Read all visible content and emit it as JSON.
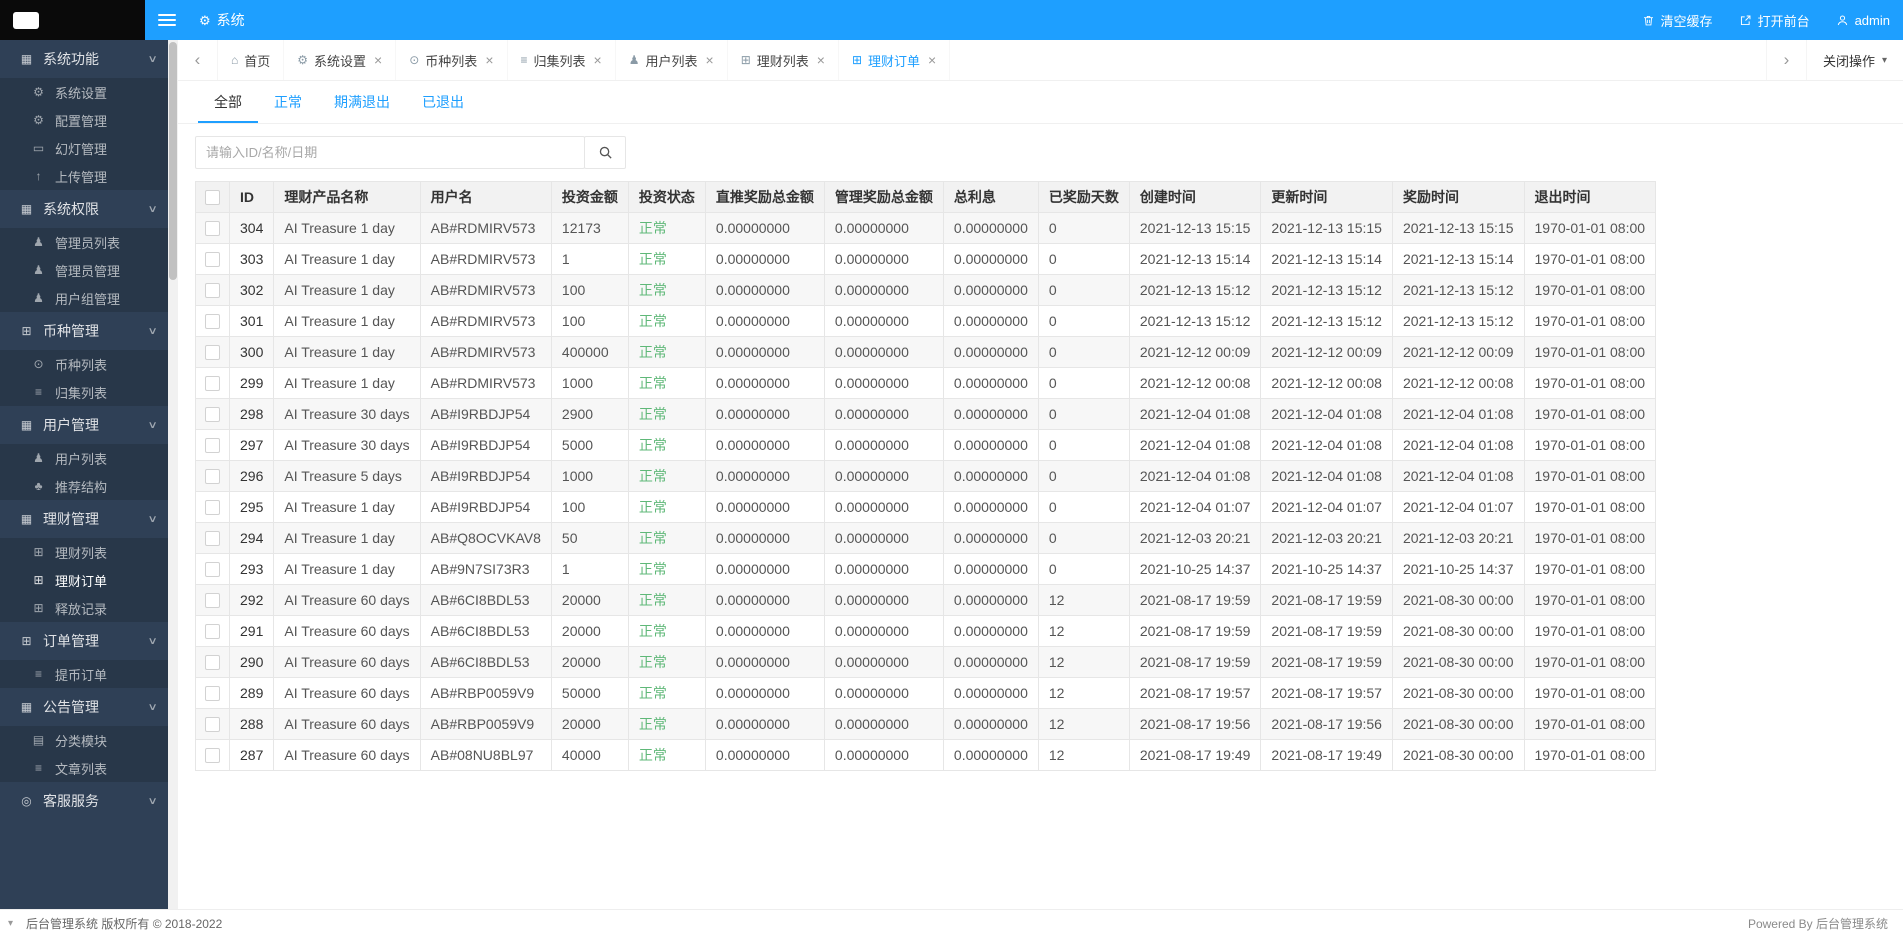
{
  "colors": {
    "primary": "#1E9FFF",
    "success": "#5FB878",
    "sidebar_bg": "#2F4056",
    "topbar_bg": "#1E9FFF"
  },
  "header": {
    "system_label": "系统",
    "actions": [
      {
        "name": "clear-cache",
        "label": "清空缓存",
        "icon": "trash-icon"
      },
      {
        "name": "open-front",
        "label": "打开前台",
        "icon": "external-link-icon"
      },
      {
        "name": "user-menu",
        "label": "admin",
        "icon": "user-icon"
      }
    ]
  },
  "sidebar": {
    "sections": [
      {
        "label": "系统功能",
        "icon": "folder-icon",
        "glyph": "▦",
        "items": [
          {
            "label": "系统设置",
            "icon": "gear-icon",
            "glyph": "⚙"
          },
          {
            "label": "配置管理",
            "icon": "gear-icon",
            "glyph": "⚙"
          },
          {
            "label": "幻灯管理",
            "icon": "slideshow-icon",
            "glyph": "▭"
          },
          {
            "label": "上传管理",
            "icon": "upload-icon",
            "glyph": "↑"
          }
        ]
      },
      {
        "label": "系统权限",
        "icon": "folder-icon",
        "glyph": "▦",
        "items": [
          {
            "label": "管理员列表",
            "icon": "user-icon",
            "glyph": "♟"
          },
          {
            "label": "管理员管理",
            "icon": "user-icon",
            "glyph": "♟"
          },
          {
            "label": "用户组管理",
            "icon": "users-icon",
            "glyph": "♟"
          }
        ]
      },
      {
        "label": "币种管理",
        "icon": "grid-icon",
        "glyph": "⊞",
        "items": [
          {
            "label": "币种列表",
            "icon": "coin-icon",
            "glyph": "⊙"
          },
          {
            "label": "归集列表",
            "icon": "list-icon",
            "glyph": "≡"
          }
        ]
      },
      {
        "label": "用户管理",
        "icon": "folder-icon",
        "glyph": "▦",
        "items": [
          {
            "label": "用户列表",
            "icon": "user-icon",
            "glyph": "♟"
          },
          {
            "label": "推荐结构",
            "icon": "tree-icon",
            "glyph": "♣"
          }
        ]
      },
      {
        "label": "理财管理",
        "icon": "folder-icon",
        "glyph": "▦",
        "items": [
          {
            "label": "理财列表",
            "icon": "grid-icon",
            "glyph": "⊞"
          },
          {
            "label": "理财订单",
            "icon": "grid-icon",
            "glyph": "⊞",
            "active": true
          },
          {
            "label": "释放记录",
            "icon": "grid-icon",
            "glyph": "⊞"
          }
        ]
      },
      {
        "label": "订单管理",
        "icon": "grid-icon",
        "glyph": "⊞",
        "items": [
          {
            "label": "提币订单",
            "icon": "list-icon",
            "glyph": "≡"
          }
        ]
      },
      {
        "label": "公告管理",
        "icon": "folder-icon",
        "glyph": "▦",
        "items": [
          {
            "label": "分类模块",
            "icon": "card-icon",
            "glyph": "▤"
          },
          {
            "label": "文章列表",
            "icon": "list-icon",
            "glyph": "≡"
          }
        ]
      },
      {
        "label": "客服服务",
        "icon": "headset-icon",
        "glyph": "◎",
        "items": []
      }
    ]
  },
  "tabbar": {
    "tabs": [
      {
        "label": "首页",
        "icon": "home-icon",
        "glyph": "⌂",
        "closable": false
      },
      {
        "label": "系统设置",
        "icon": "wrench-icon",
        "glyph": "⚙",
        "closable": true
      },
      {
        "label": "币种列表",
        "icon": "coin-icon",
        "glyph": "⊙",
        "closable": true
      },
      {
        "label": "归集列表",
        "icon": "list-icon",
        "glyph": "≡",
        "closable": true
      },
      {
        "label": "用户列表",
        "icon": "user-icon",
        "glyph": "♟",
        "closable": true
      },
      {
        "label": "理财列表",
        "icon": "grid-icon",
        "glyph": "⊞",
        "closable": true
      },
      {
        "label": "理财订单",
        "icon": "grid-icon",
        "glyph": "⊞",
        "closable": true,
        "active": true
      }
    ],
    "close_menu_label": "关闭操作"
  },
  "filters": {
    "tabs": [
      {
        "label": "全部",
        "active": true
      },
      {
        "label": "正常"
      },
      {
        "label": "期满退出"
      },
      {
        "label": "已退出"
      }
    ]
  },
  "search": {
    "placeholder": "请输入ID/名称/日期"
  },
  "table": {
    "columns": [
      {
        "key": "id",
        "label": "ID"
      },
      {
        "key": "product",
        "label": "理财产品名称"
      },
      {
        "key": "username",
        "label": "用户名"
      },
      {
        "key": "amount",
        "label": "投资金额"
      },
      {
        "key": "status",
        "label": "投资状态"
      },
      {
        "key": "direct_reward",
        "label": "直推奖励总金额"
      },
      {
        "key": "manage_reward",
        "label": "管理奖励总金额"
      },
      {
        "key": "interest",
        "label": "总利息"
      },
      {
        "key": "reward_days",
        "label": "已奖励天数"
      },
      {
        "key": "created_at",
        "label": "创建时间"
      },
      {
        "key": "updated_at",
        "label": "更新时间"
      },
      {
        "key": "reward_at",
        "label": "奖励时间"
      },
      {
        "key": "exit_at",
        "label": "退出时间"
      }
    ],
    "rows": [
      {
        "id": "304",
        "product": "AI Treasure 1 day",
        "username": "AB#RDMIRV573",
        "amount": "12173",
        "status": "正常",
        "direct_reward": "0.00000000",
        "manage_reward": "0.00000000",
        "interest": "0.00000000",
        "reward_days": "0",
        "created_at": "2021-12-13 15:15",
        "updated_at": "2021-12-13 15:15",
        "reward_at": "2021-12-13 15:15",
        "exit_at": "1970-01-01 08:00"
      },
      {
        "id": "303",
        "product": "AI Treasure 1 day",
        "username": "AB#RDMIRV573",
        "amount": "1",
        "status": "正常",
        "direct_reward": "0.00000000",
        "manage_reward": "0.00000000",
        "interest": "0.00000000",
        "reward_days": "0",
        "created_at": "2021-12-13 15:14",
        "updated_at": "2021-12-13 15:14",
        "reward_at": "2021-12-13 15:14",
        "exit_at": "1970-01-01 08:00"
      },
      {
        "id": "302",
        "product": "AI Treasure 1 day",
        "username": "AB#RDMIRV573",
        "amount": "100",
        "status": "正常",
        "direct_reward": "0.00000000",
        "manage_reward": "0.00000000",
        "interest": "0.00000000",
        "reward_days": "0",
        "created_at": "2021-12-13 15:12",
        "updated_at": "2021-12-13 15:12",
        "reward_at": "2021-12-13 15:12",
        "exit_at": "1970-01-01 08:00"
      },
      {
        "id": "301",
        "product": "AI Treasure 1 day",
        "username": "AB#RDMIRV573",
        "amount": "100",
        "status": "正常",
        "direct_reward": "0.00000000",
        "manage_reward": "0.00000000",
        "interest": "0.00000000",
        "reward_days": "0",
        "created_at": "2021-12-13 15:12",
        "updated_at": "2021-12-13 15:12",
        "reward_at": "2021-12-13 15:12",
        "exit_at": "1970-01-01 08:00"
      },
      {
        "id": "300",
        "product": "AI Treasure 1 day",
        "username": "AB#RDMIRV573",
        "amount": "400000",
        "status": "正常",
        "direct_reward": "0.00000000",
        "manage_reward": "0.00000000",
        "interest": "0.00000000",
        "reward_days": "0",
        "created_at": "2021-12-12 00:09",
        "updated_at": "2021-12-12 00:09",
        "reward_at": "2021-12-12 00:09",
        "exit_at": "1970-01-01 08:00"
      },
      {
        "id": "299",
        "product": "AI Treasure 1 day",
        "username": "AB#RDMIRV573",
        "amount": "1000",
        "status": "正常",
        "direct_reward": "0.00000000",
        "manage_reward": "0.00000000",
        "interest": "0.00000000",
        "reward_days": "0",
        "created_at": "2021-12-12 00:08",
        "updated_at": "2021-12-12 00:08",
        "reward_at": "2021-12-12 00:08",
        "exit_at": "1970-01-01 08:00"
      },
      {
        "id": "298",
        "product": "AI Treasure 30 days",
        "username": "AB#I9RBDJP54",
        "amount": "2900",
        "status": "正常",
        "direct_reward": "0.00000000",
        "manage_reward": "0.00000000",
        "interest": "0.00000000",
        "reward_days": "0",
        "created_at": "2021-12-04 01:08",
        "updated_at": "2021-12-04 01:08",
        "reward_at": "2021-12-04 01:08",
        "exit_at": "1970-01-01 08:00"
      },
      {
        "id": "297",
        "product": "AI Treasure 30 days",
        "username": "AB#I9RBDJP54",
        "amount": "5000",
        "status": "正常",
        "direct_reward": "0.00000000",
        "manage_reward": "0.00000000",
        "interest": "0.00000000",
        "reward_days": "0",
        "created_at": "2021-12-04 01:08",
        "updated_at": "2021-12-04 01:08",
        "reward_at": "2021-12-04 01:08",
        "exit_at": "1970-01-01 08:00"
      },
      {
        "id": "296",
        "product": "AI Treasure 5 days",
        "username": "AB#I9RBDJP54",
        "amount": "1000",
        "status": "正常",
        "direct_reward": "0.00000000",
        "manage_reward": "0.00000000",
        "interest": "0.00000000",
        "reward_days": "0",
        "created_at": "2021-12-04 01:08",
        "updated_at": "2021-12-04 01:08",
        "reward_at": "2021-12-04 01:08",
        "exit_at": "1970-01-01 08:00"
      },
      {
        "id": "295",
        "product": "AI Treasure 1 day",
        "username": "AB#I9RBDJP54",
        "amount": "100",
        "status": "正常",
        "direct_reward": "0.00000000",
        "manage_reward": "0.00000000",
        "interest": "0.00000000",
        "reward_days": "0",
        "created_at": "2021-12-04 01:07",
        "updated_at": "2021-12-04 01:07",
        "reward_at": "2021-12-04 01:07",
        "exit_at": "1970-01-01 08:00"
      },
      {
        "id": "294",
        "product": "AI Treasure 1 day",
        "username": "AB#Q8OCVKAV8",
        "amount": "50",
        "status": "正常",
        "direct_reward": "0.00000000",
        "manage_reward": "0.00000000",
        "interest": "0.00000000",
        "reward_days": "0",
        "created_at": "2021-12-03 20:21",
        "updated_at": "2021-12-03 20:21",
        "reward_at": "2021-12-03 20:21",
        "exit_at": "1970-01-01 08:00"
      },
      {
        "id": "293",
        "product": "AI Treasure 1 day",
        "username": "AB#9N7SI73R3",
        "amount": "1",
        "status": "正常",
        "direct_reward": "0.00000000",
        "manage_reward": "0.00000000",
        "interest": "0.00000000",
        "reward_days": "0",
        "created_at": "2021-10-25 14:37",
        "updated_at": "2021-10-25 14:37",
        "reward_at": "2021-10-25 14:37",
        "exit_at": "1970-01-01 08:00"
      },
      {
        "id": "292",
        "product": "AI Treasure 60 days",
        "username": "AB#6CI8BDL53",
        "amount": "20000",
        "status": "正常",
        "direct_reward": "0.00000000",
        "manage_reward": "0.00000000",
        "interest": "0.00000000",
        "reward_days": "12",
        "created_at": "2021-08-17 19:59",
        "updated_at": "2021-08-17 19:59",
        "reward_at": "2021-08-30 00:00",
        "exit_at": "1970-01-01 08:00"
      },
      {
        "id": "291",
        "product": "AI Treasure 60 days",
        "username": "AB#6CI8BDL53",
        "amount": "20000",
        "status": "正常",
        "direct_reward": "0.00000000",
        "manage_reward": "0.00000000",
        "interest": "0.00000000",
        "reward_days": "12",
        "created_at": "2021-08-17 19:59",
        "updated_at": "2021-08-17 19:59",
        "reward_at": "2021-08-30 00:00",
        "exit_at": "1970-01-01 08:00"
      },
      {
        "id": "290",
        "product": "AI Treasure 60 days",
        "username": "AB#6CI8BDL53",
        "amount": "20000",
        "status": "正常",
        "direct_reward": "0.00000000",
        "manage_reward": "0.00000000",
        "interest": "0.00000000",
        "reward_days": "12",
        "created_at": "2021-08-17 19:59",
        "updated_at": "2021-08-17 19:59",
        "reward_at": "2021-08-30 00:00",
        "exit_at": "1970-01-01 08:00"
      },
      {
        "id": "289",
        "product": "AI Treasure 60 days",
        "username": "AB#RBP0059V9",
        "amount": "50000",
        "status": "正常",
        "direct_reward": "0.00000000",
        "manage_reward": "0.00000000",
        "interest": "0.00000000",
        "reward_days": "12",
        "created_at": "2021-08-17 19:57",
        "updated_at": "2021-08-17 19:57",
        "reward_at": "2021-08-30 00:00",
        "exit_at": "1970-01-01 08:00"
      },
      {
        "id": "288",
        "product": "AI Treasure 60 days",
        "username": "AB#RBP0059V9",
        "amount": "20000",
        "status": "正常",
        "direct_reward": "0.00000000",
        "manage_reward": "0.00000000",
        "interest": "0.00000000",
        "reward_days": "12",
        "created_at": "2021-08-17 19:56",
        "updated_at": "2021-08-17 19:56",
        "reward_at": "2021-08-30 00:00",
        "exit_at": "1970-01-01 08:00"
      },
      {
        "id": "287",
        "product": "AI Treasure 60 days",
        "username": "AB#08NU8BL97",
        "amount": "40000",
        "status": "正常",
        "direct_reward": "0.00000000",
        "manage_reward": "0.00000000",
        "interest": "0.00000000",
        "reward_days": "12",
        "created_at": "2021-08-17 19:49",
        "updated_at": "2021-08-17 19:49",
        "reward_at": "2021-08-30 00:00",
        "exit_at": "1970-01-01 08:00"
      }
    ]
  },
  "footer": {
    "copyright": "后台管理系统 版权所有 © 2018-2022",
    "powered": "Powered By 后台管理系统"
  }
}
